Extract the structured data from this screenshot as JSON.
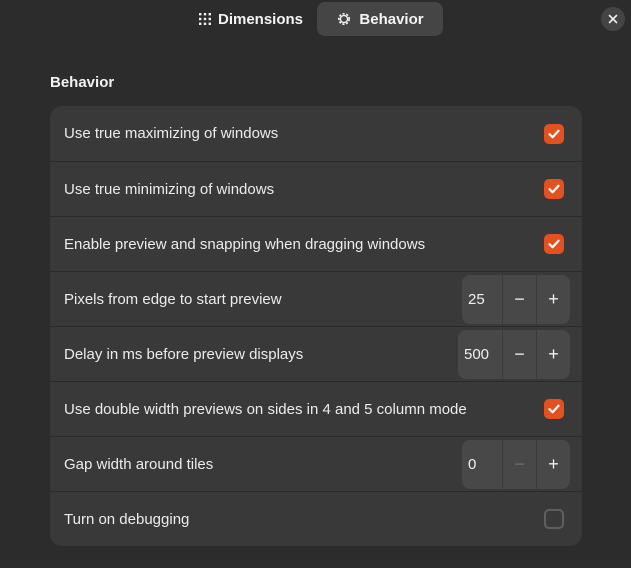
{
  "header": {
    "tabs": [
      {
        "label": "Dimensions",
        "icon": "grid-dots-icon",
        "active": false
      },
      {
        "label": "Behavior",
        "icon": "gear-icon",
        "active": true
      }
    ],
    "close_icon": "close-icon"
  },
  "section": {
    "title": "Behavior"
  },
  "rows": [
    {
      "label": "Use true maximizing of windows",
      "type": "checkbox",
      "checked": true
    },
    {
      "label": "Use true minimizing of windows",
      "type": "checkbox",
      "checked": true
    },
    {
      "label": "Enable preview and snapping when dragging windows",
      "type": "checkbox",
      "checked": true
    },
    {
      "label": "Pixels from edge to start preview",
      "type": "spin",
      "value": "25",
      "minus": "−",
      "plus": "+"
    },
    {
      "label": "Delay in ms before preview displays",
      "type": "spin",
      "value": "500",
      "minus": "−",
      "plus": "+"
    },
    {
      "label": "Use double width previews on sides in 4 and 5 column mode",
      "type": "checkbox",
      "checked": true
    },
    {
      "label": "Gap width around tiles",
      "type": "spin",
      "value": "0",
      "minus": "−",
      "plus": "+",
      "minus_disabled": true
    },
    {
      "label": "Turn on debugging",
      "type": "checkbox",
      "checked": false
    }
  ],
  "colors": {
    "accent": "#e2511f",
    "background": "#2c2c2c",
    "group": "#393939"
  }
}
